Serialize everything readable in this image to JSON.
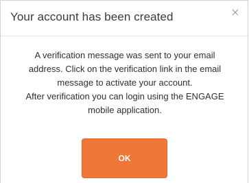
{
  "dialog": {
    "title": "Your account has been created",
    "close_icon": "close-icon",
    "message_lines": [
      "A verification message was sent to your email",
      "address. Click on the verification link in the email",
      "message to activate your account.",
      "After verification you can login using the ENGAGE",
      "mobile application."
    ],
    "ok_label": "OK"
  },
  "colors": {
    "accent": "#f07737",
    "title_text": "#3a3a3a",
    "body_text": "#2f2f2f",
    "divider": "#e2e2e2"
  }
}
